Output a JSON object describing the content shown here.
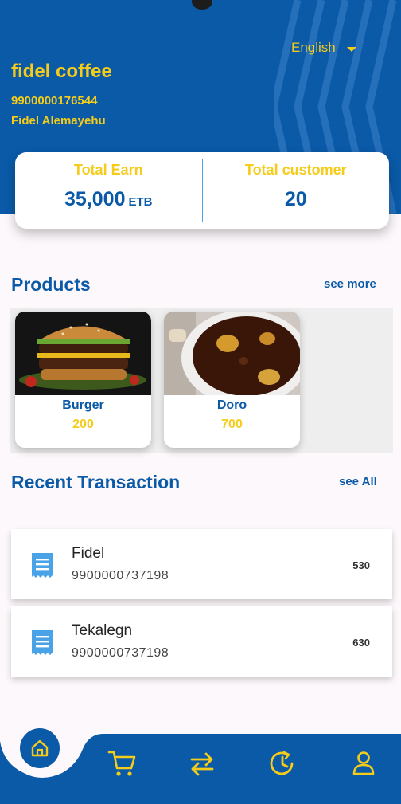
{
  "header": {
    "language": "English",
    "shop_name": "fidel coffee",
    "shop_phone": "9900000176544",
    "owner_name": "Fidel Alemayehu"
  },
  "stats": {
    "total_earn_label": "Total Earn",
    "total_earn_value": "35,000",
    "total_earn_unit": "ETB",
    "total_customer_label": "Total customer",
    "total_customer_value": "20"
  },
  "products_section": {
    "title": "Products",
    "see_more": "see more",
    "items": [
      {
        "name": "Burger",
        "price": "200"
      },
      {
        "name": "Doro",
        "price": "700"
      }
    ]
  },
  "transactions_section": {
    "title": "Recent Transaction",
    "see_all": "see All",
    "items": [
      {
        "name": "Fidel",
        "phone": "9900000737198",
        "amount": "530"
      },
      {
        "name": "Tekalegn",
        "phone": "9900000737198",
        "amount": "630"
      }
    ]
  },
  "colors": {
    "primary": "#0a5aa8",
    "accent": "#f5cc1a",
    "background": "#fdf8fb"
  },
  "nav": {
    "items": [
      "home-icon",
      "cart-icon",
      "transfer-icon",
      "history-icon",
      "profile-icon"
    ],
    "active": "home-icon"
  }
}
